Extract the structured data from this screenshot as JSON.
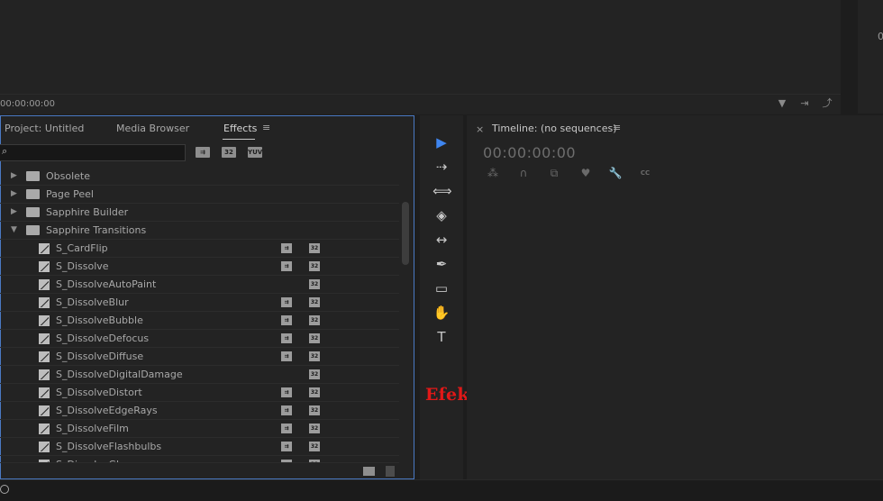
{
  "top": {
    "timecode": "00:00:00:00",
    "right_char": "0"
  },
  "project_panel": {
    "tabs": [
      {
        "label": "Project: Untitled"
      },
      {
        "label": "Media Browser"
      },
      {
        "label": "Effects"
      }
    ],
    "menu_glyph": "≡",
    "search": {
      "placeholder": "",
      "value": ""
    },
    "filter_badges": [
      "⇉",
      "32",
      "YUV"
    ],
    "folders": [
      {
        "label": "Obsolete",
        "expanded": false
      },
      {
        "label": "Page Peel",
        "expanded": false
      },
      {
        "label": "Sapphire Builder",
        "expanded": false
      },
      {
        "label": "Sapphire Transitions",
        "expanded": true
      }
    ],
    "effects": [
      {
        "label": "S_CardFlip",
        "accel": true,
        "bit32": true
      },
      {
        "label": "S_Dissolve",
        "accel": true,
        "bit32": true
      },
      {
        "label": "S_DissolveAutoPaint",
        "accel": false,
        "bit32": true
      },
      {
        "label": "S_DissolveBlur",
        "accel": true,
        "bit32": true
      },
      {
        "label": "S_DissolveBubble",
        "accel": true,
        "bit32": true
      },
      {
        "label": "S_DissolveDefocus",
        "accel": true,
        "bit32": true
      },
      {
        "label": "S_DissolveDiffuse",
        "accel": true,
        "bit32": true
      },
      {
        "label": "S_DissolveDigitalDamage",
        "accel": false,
        "bit32": true
      },
      {
        "label": "S_DissolveDistort",
        "accel": true,
        "bit32": true
      },
      {
        "label": "S_DissolveEdgeRays",
        "accel": true,
        "bit32": true
      },
      {
        "label": "S_DissolveFilm",
        "accel": true,
        "bit32": true
      },
      {
        "label": "S_DissolveFlashbulbs",
        "accel": true,
        "bit32": true
      },
      {
        "label": "S_DissolveGlow",
        "accel": true,
        "bit32": true
      }
    ]
  },
  "tools": [
    {
      "icon": "selection-tool-icon",
      "glyph": "▶"
    },
    {
      "icon": "track-select-tool-icon",
      "glyph": "⇢"
    },
    {
      "icon": "ripple-edit-tool-icon",
      "glyph": "⟺"
    },
    {
      "icon": "razor-tool-icon",
      "glyph": "◈"
    },
    {
      "icon": "slip-tool-icon",
      "glyph": "↔"
    },
    {
      "icon": "pen-tool-icon",
      "glyph": "✒"
    },
    {
      "icon": "rectangle-tool-icon",
      "glyph": "▭"
    },
    {
      "icon": "hand-tool-icon",
      "glyph": "✋"
    },
    {
      "icon": "type-tool-icon",
      "glyph": "T"
    }
  ],
  "overlay": {
    "caption": "Efek Plugin",
    "color": "#e11818"
  },
  "timeline": {
    "close_glyph": "×",
    "title": "Timeline: (no sequences)",
    "menu_glyph": "≡",
    "timecode": "00:00:00:00",
    "icons": [
      "nest-icon",
      "snap-icon",
      "linked-selection-icon",
      "marker-icon",
      "wrench-icon",
      "captions-icon"
    ],
    "cc_label": "CC"
  },
  "colors": {
    "accent": "#3f86f0",
    "panel_focus_border": "#4a79c3",
    "panel_bg": "#232323"
  }
}
